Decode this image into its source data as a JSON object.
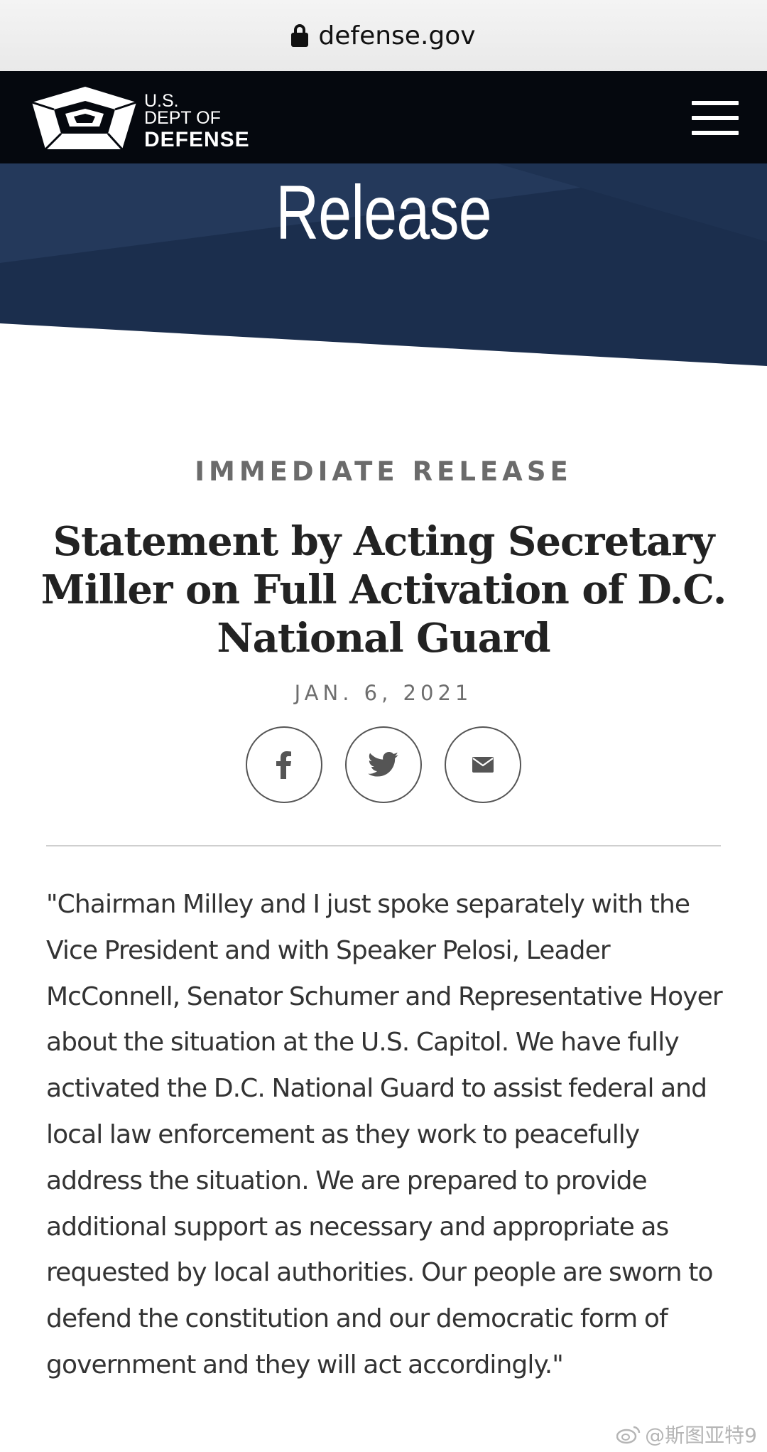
{
  "browser": {
    "url": "defense.gov"
  },
  "header": {
    "logo_line1": "U.S.",
    "logo_line2": "DEPT OF",
    "logo_line3": "DEFENSE",
    "menu_icon": "hamburger-menu-icon"
  },
  "banner": {
    "title": "Release"
  },
  "article": {
    "kicker": "IMMEDIATE RELEASE",
    "headline": "Statement by Acting Secretary Miller on Full Activation of D.C. National Guard",
    "date": "JAN. 6, 2021",
    "share": [
      {
        "icon": "facebook-icon"
      },
      {
        "icon": "twitter-icon"
      },
      {
        "icon": "email-icon"
      }
    ],
    "body": "\"Chairman Milley and I just spoke separately with the Vice President and with Speaker Pelosi, Leader McConnell, Senator Schumer and Representative Hoyer about the situation at the U.S. Capitol. We have fully activated the D.C. National Guard to assist federal and local law enforcement as they work to peacefully address the situation. We are prepared to provide additional support as necessary and appropriate as requested by local authorities. Our people are sworn to defend the constitution and our democratic form of government and they will act accordingly.\""
  },
  "watermark": {
    "text": "@斯图亚特9"
  },
  "colors": {
    "header_bg": "#05080e",
    "banner_dark": "#1b2e4d",
    "banner_light": "#2a4063",
    "text": "#333333",
    "muted": "#6b6b6b"
  }
}
